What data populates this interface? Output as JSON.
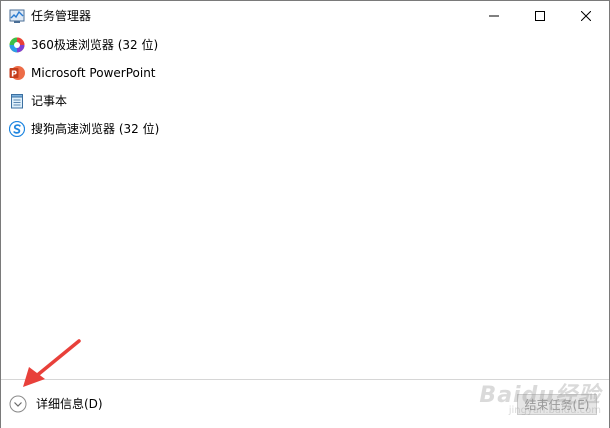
{
  "window": {
    "title": "任务管理器",
    "controls": [
      "minimize",
      "maximize",
      "close"
    ]
  },
  "tasks": [
    {
      "label": "360极速浏览器 (32 位)",
      "icon": "360-browser-icon"
    },
    {
      "label": "Microsoft PowerPoint",
      "icon": "powerpoint-icon"
    },
    {
      "label": "记事本",
      "icon": "notepad-icon"
    },
    {
      "label": "搜狗高速浏览器 (32 位)",
      "icon": "sogou-browser-icon"
    }
  ],
  "footer": {
    "details_label": "详细信息(D)",
    "end_task_label": "结束任务(E)"
  },
  "watermark": {
    "brand": "Baidu经验",
    "url": "jingyan.baidu.com"
  },
  "colors": {
    "annotation_arrow": "#e8403a",
    "disabled_button_bg": "#e6e6e6",
    "disabled_text": "#9a9a9a",
    "divider": "#d6d6d6"
  }
}
